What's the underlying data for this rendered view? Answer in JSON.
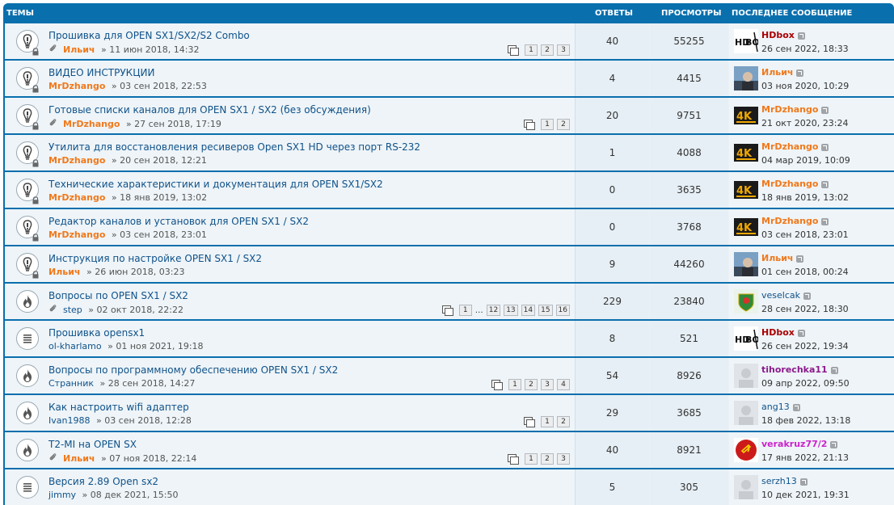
{
  "header": {
    "topics": "Темы",
    "replies": "Ответы",
    "views": "Просмотры",
    "last_post": "Последнее сообщение"
  },
  "colors": {
    "header_bg": "#0a6fad",
    "link": "#105289",
    "author_orange": "#f0791c",
    "hdbox_red": "#aa0000",
    "purple": "#8b1a8b",
    "magenta": "#cc22cc"
  },
  "topics": [
    {
      "title": "Прошивка для OPEN SX1/SX2/S2 Combo",
      "author": "Ильич",
      "author_style": "orange",
      "date": "» 11 июн 2018, 14:32",
      "attach": true,
      "pages": [
        "1",
        "2",
        "3"
      ],
      "replies": "40",
      "views": "55255",
      "last_user": "HDbox",
      "last_style": "hdbox",
      "last_date": "26 сен 2022, 18:33",
      "avatar": "hdbox",
      "icon": "locked"
    },
    {
      "title": "ВИДЕО ИНСТРУКЦИИ",
      "author": "MrDzhango",
      "author_style": "orange",
      "date": "» 03 сен 2018, 22:53",
      "attach": false,
      "pages": [],
      "replies": "4",
      "views": "4415",
      "last_user": "Ильич",
      "last_style": "orange",
      "last_date": "03 ноя 2020, 10:29",
      "avatar": "photo",
      "icon": "locked"
    },
    {
      "title": "Готовые списки каналов для OPEN SX1 / SX2 (без обсуждения)",
      "author": "MrDzhango",
      "author_style": "orange",
      "date": "» 27 сен 2018, 17:19",
      "attach": true,
      "pages": [
        "1",
        "2"
      ],
      "replies": "20",
      "views": "9751",
      "last_user": "MrDzhango",
      "last_style": "orange",
      "last_date": "21 окт 2020, 23:24",
      "avatar": "4k",
      "icon": "locked"
    },
    {
      "title": "Утилита для восстановления ресиверов Open SX1 HD через порт RS-232",
      "author": "MrDzhango",
      "author_style": "orange",
      "date": "» 20 сен 2018, 12:21",
      "attach": false,
      "pages": [],
      "replies": "1",
      "views": "4088",
      "last_user": "MrDzhango",
      "last_style": "orange",
      "last_date": "04 мар 2019, 10:09",
      "avatar": "4k",
      "icon": "locked"
    },
    {
      "title": "Технические характеристики и документация для OPEN SX1/SX2",
      "author": "MrDzhango",
      "author_style": "orange",
      "date": "» 18 янв 2019, 13:02",
      "attach": false,
      "pages": [],
      "replies": "0",
      "views": "3635",
      "last_user": "MrDzhango",
      "last_style": "orange",
      "last_date": "18 янв 2019, 13:02",
      "avatar": "4k",
      "icon": "locked"
    },
    {
      "title": "Редактор каналов и установок для OPEN SX1 / SX2",
      "author": "MrDzhango",
      "author_style": "orange",
      "date": "» 03 сен 2018, 23:01",
      "attach": false,
      "pages": [],
      "replies": "0",
      "views": "3768",
      "last_user": "MrDzhango",
      "last_style": "orange",
      "last_date": "03 сен 2018, 23:01",
      "avatar": "4k",
      "icon": "locked"
    },
    {
      "title": "Инструкция по настройке OPEN SX1 / SX2",
      "author": "Ильич",
      "author_style": "orange",
      "date": "» 26 июн 2018, 03:23",
      "attach": false,
      "pages": [],
      "replies": "9",
      "views": "44260",
      "last_user": "Ильич",
      "last_style": "orange",
      "last_date": "01 сен 2018, 00:24",
      "avatar": "photo",
      "icon": "locked"
    },
    {
      "title": "Вопросы по OPEN SX1 / SX2",
      "author": "step",
      "author_style": "plain",
      "date": "» 02 окт 2018, 22:22",
      "attach": true,
      "pages": [
        "1",
        "…",
        "12",
        "13",
        "14",
        "15",
        "16"
      ],
      "replies": "229",
      "views": "23840",
      "last_user": "veselcak",
      "last_style": "plain",
      "last_date": "28 сен 2022, 18:30",
      "avatar": "crest",
      "icon": "hot"
    },
    {
      "title": "Прошивка opensx1",
      "author": "ol-kharlamo",
      "author_style": "plain",
      "date": "» 01 ноя 2021, 19:18",
      "attach": false,
      "pages": [],
      "replies": "8",
      "views": "521",
      "last_user": "HDbox",
      "last_style": "hdbox",
      "last_date": "26 сен 2022, 19:34",
      "avatar": "hdbox",
      "icon": "normal"
    },
    {
      "title": "Вопросы по программному обеспечению OPEN SX1 / SX2",
      "author": "Странник",
      "author_style": "plain",
      "date": "» 28 сен 2018, 14:27",
      "attach": false,
      "pages": [
        "1",
        "2",
        "3",
        "4"
      ],
      "replies": "54",
      "views": "8926",
      "last_user": "tihorechka11",
      "last_style": "purple",
      "last_date": "09 апр 2022, 09:50",
      "avatar": "blank",
      "icon": "hot"
    },
    {
      "title": "Как настроить wifi адаптер",
      "author": "Ivan1988",
      "author_style": "plain",
      "date": "» 03 сен 2018, 12:28",
      "attach": false,
      "pages": [
        "1",
        "2"
      ],
      "replies": "29",
      "views": "3685",
      "last_user": "ang13",
      "last_style": "plain",
      "last_date": "18 фев 2022, 13:18",
      "avatar": "blank",
      "icon": "hot"
    },
    {
      "title": "T2-MI на OPEN SX",
      "author": "Ильич",
      "author_style": "orange",
      "date": "» 07 ноя 2018, 22:14",
      "attach": true,
      "pages": [
        "1",
        "2",
        "3"
      ],
      "replies": "40",
      "views": "8921",
      "last_user": "verakruz77/2",
      "last_style": "magenta",
      "last_date": "17 янв 2022, 21:13",
      "avatar": "ussr",
      "icon": "hot"
    },
    {
      "title": "Версия 2.89 Open sx2",
      "author": "jimmy",
      "author_style": "plain",
      "date": "» 08 дек 2021, 15:50",
      "attach": false,
      "pages": [],
      "replies": "5",
      "views": "305",
      "last_user": "serzh13",
      "last_style": "plain",
      "last_date": "10 дек 2021, 19:31",
      "avatar": "blank",
      "icon": "normal"
    }
  ]
}
